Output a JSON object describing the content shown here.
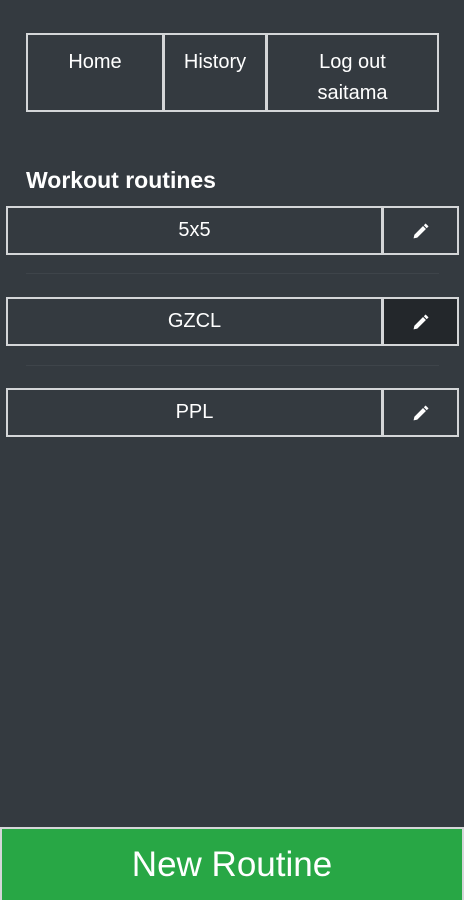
{
  "nav": {
    "home_label": "Home",
    "history_label": "History",
    "logout_label": "Log out",
    "username": "saitama"
  },
  "section": {
    "title": "Workout routines"
  },
  "routines": [
    {
      "name": "5x5",
      "edit_icon": "pencil-icon"
    },
    {
      "name": "GZCL",
      "edit_icon": "pencil-icon"
    },
    {
      "name": "PPL",
      "edit_icon": "pencil-icon"
    }
  ],
  "actions": {
    "new_routine_label": "New Routine"
  },
  "colors": {
    "background": "#343a40",
    "accent_green": "#28a745",
    "border": "#d4d6d8",
    "active_edit": "#23272b"
  }
}
